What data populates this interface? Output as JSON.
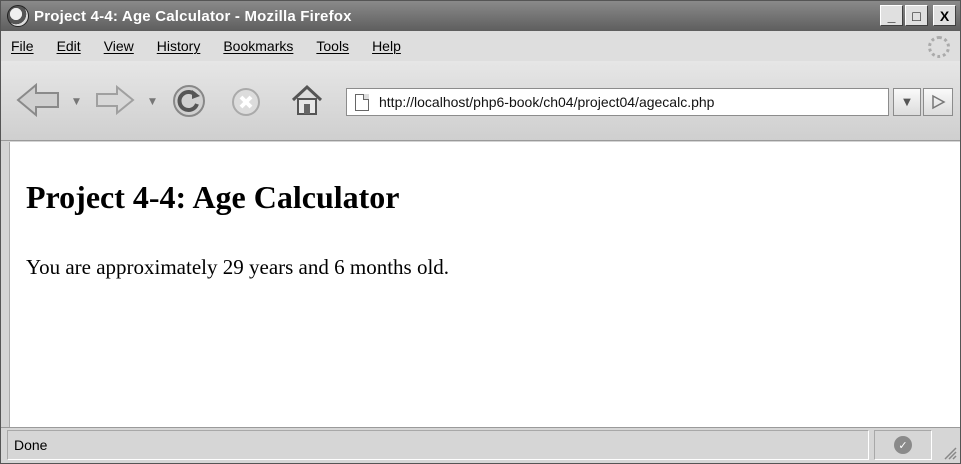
{
  "window": {
    "title": "Project 4-4: Age Calculator - Mozilla Firefox",
    "controls": {
      "minimize": "_",
      "maximize": "□",
      "close": "X"
    }
  },
  "menu": {
    "items": [
      {
        "label": "File"
      },
      {
        "label": "Edit"
      },
      {
        "label": "View"
      },
      {
        "label": "History"
      },
      {
        "label": "Bookmarks"
      },
      {
        "label": "Tools"
      },
      {
        "label": "Help"
      }
    ]
  },
  "toolbar": {
    "url": "http://localhost/php6-book/ch04/project04/agecalc.php",
    "icons": [
      "back-arrow-icon",
      "forward-arrow-icon",
      "reload-icon",
      "stop-icon",
      "home-icon",
      "page-icon",
      "go-icon"
    ]
  },
  "page": {
    "heading": "Project 4-4: Age Calculator",
    "message": "You are approximately 29 years and 6 months old."
  },
  "status": {
    "text": "Done"
  }
}
